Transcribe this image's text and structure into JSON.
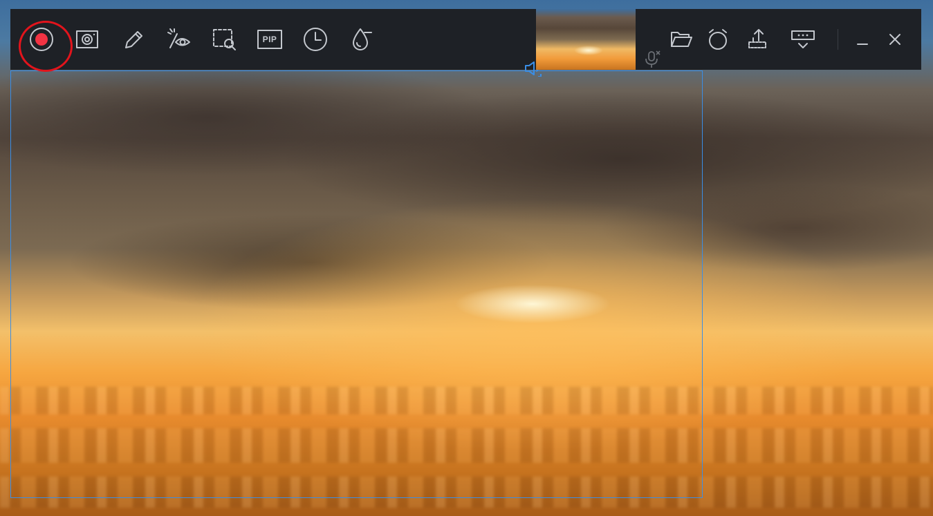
{
  "toolbar": {
    "left_tools": [
      {
        "name": "record-icon"
      },
      {
        "name": "screenshot-icon"
      },
      {
        "name": "pencil-icon"
      },
      {
        "name": "eye-effect-icon"
      },
      {
        "name": "zoom-region-icon"
      },
      {
        "name": "pip-icon",
        "label": "PIP"
      },
      {
        "name": "clock-icon"
      },
      {
        "name": "watermark-icon"
      }
    ],
    "right_tools": [
      {
        "name": "folder-icon"
      },
      {
        "name": "alarm-icon"
      },
      {
        "name": "export-icon"
      },
      {
        "name": "dropdown-menu-icon"
      },
      {
        "name": "minimize-icon"
      },
      {
        "name": "close-icon"
      }
    ],
    "speaker": {
      "name": "speaker-icon",
      "state": "on"
    },
    "microphone": {
      "name": "microphone-muted-icon",
      "state": "muted"
    }
  },
  "colors": {
    "toolbar_bg": "#1e2126",
    "icon": "#c4c8ce",
    "record_red": "#f23343",
    "highlight_red": "#e2141c",
    "region_blue": "#3a8ee6"
  }
}
